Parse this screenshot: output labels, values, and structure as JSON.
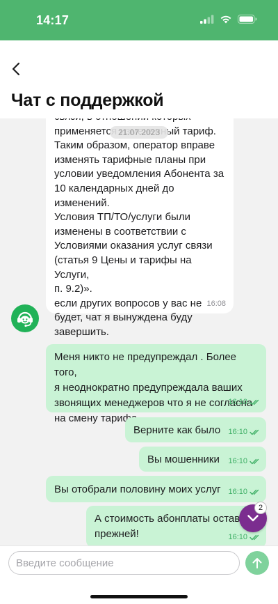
{
  "status_bar": {
    "time": "14:17",
    "color": "#4fb56f"
  },
  "header": {
    "back_icon": "chevron-left-icon",
    "title": "Чат с поддержкой"
  },
  "chat": {
    "date_separator": "21.07.2023",
    "incoming": [
      {
        "text": "связи, в отношении которых\nприменяется измененный тариф.\nТаким образом, оператор вправе\nизменять тарифные планы при\nусловии уведомления Абонента за\n10 календарных дней до\nизменений.\nУсловия ТП/ТО/услуги были\nизменены в соответствии с\nУсловиями оказания услуг связи\n(статья 9 Цены и тарифы на Услуги,\nп. 9.2)».\nесли других вопросов у вас не\nбудет, чат я вынуждена буду\nзавершить.",
        "time": "16:08",
        "avatar_icon": "support-operator-icon"
      }
    ],
    "outgoing": [
      {
        "text": "Меня никто не предупреждал . Более того,\nя неоднократно предупреждала ваших\nзвонящих менеджеров что я не согласна\nна смену тарифа",
        "time": "16:10",
        "status_icon": "double-check-icon"
      },
      {
        "text": "Верните как было",
        "time": "16:10",
        "status_icon": "double-check-icon"
      },
      {
        "text": "Вы мошенники",
        "time": "16:10",
        "status_icon": "double-check-icon"
      },
      {
        "text": "Вы отобрали половину моих услуг",
        "time": "16:10",
        "status_icon": "double-check-icon"
      },
      {
        "text": "А стоимость абонплаты оставили\nпрежней!",
        "time": "16:10",
        "status_icon": "double-check-icon"
      }
    ],
    "scroll_down": {
      "icon": "chevron-down-icon",
      "badge": "2",
      "color": "#7b2d8f"
    }
  },
  "composer": {
    "placeholder": "Введите сообщение",
    "value": "",
    "send_icon": "arrow-up-icon",
    "send_color": "#7fd29c"
  },
  "colors": {
    "accent": "#21b258",
    "outgoing_bubble": "#c9f3d5",
    "incoming_bubble": "#ffffff"
  }
}
